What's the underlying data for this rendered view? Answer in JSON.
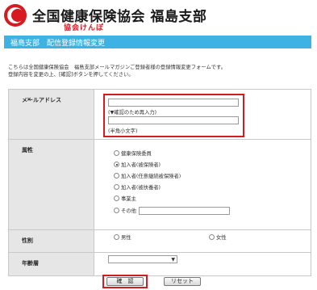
{
  "header": {
    "org_name": "全国健康保険協会 福島支部",
    "logo_sub": "協会けんぽ",
    "brand_color": "#d71920"
  },
  "title_bar": {
    "text": "福島支部　配信登録情報変更",
    "color": "#3db2e3"
  },
  "intro": {
    "line1": "こちらは全国健康保険協会　福島支部メールマガジンご登録者様の登録情報変更フォームです。",
    "line2": "登録内容を変更の上、[確認]ボタンを押してください。"
  },
  "form": {
    "required_mark": "×",
    "email": {
      "label": "メールアドレス",
      "value": "",
      "confirm_note": "(▼確認のため再入力)",
      "confirm_value": "",
      "hint": "(半角小文字)"
    },
    "attribute": {
      "label": "属性",
      "options": [
        "健康保険委員",
        "加入者(被保険者)",
        "加入者(任意継続被保険者)",
        "加入者(被扶養者)",
        "事業主",
        "その他"
      ],
      "selected": "加入者(被保険者)",
      "other_value": ""
    },
    "gender": {
      "label": "性別",
      "options": [
        "男性",
        "女性"
      ]
    },
    "age": {
      "label": "年齢層",
      "selected": ""
    }
  },
  "buttons": {
    "confirm": "確　認",
    "reset": "リセット"
  }
}
